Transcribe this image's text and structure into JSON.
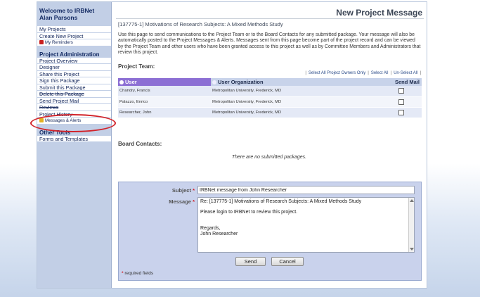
{
  "sidebar": {
    "welcome_line1": "Welcome to IRBNet",
    "welcome_line2": "Alan Parsons",
    "top_items": [
      {
        "label": "My Projects"
      },
      {
        "label": "Create New Project"
      },
      {
        "label": "My Reminders",
        "icon": "reminder-icon",
        "color": "#c8201e"
      }
    ],
    "project_admin_heading": "Project Administration",
    "admin_items": [
      {
        "label": "Project Overview"
      },
      {
        "label": "Designer"
      },
      {
        "label": "Share this Project"
      },
      {
        "label": "Sign this Package"
      },
      {
        "label": "Submit this Package"
      },
      {
        "label": "Delete this Package"
      },
      {
        "label": "Send Project Mail"
      },
      {
        "label": "Reviews"
      },
      {
        "label": "Project History"
      },
      {
        "label": "Messages & Alerts",
        "icon": "messages-icon",
        "color": "#e3b11f"
      }
    ],
    "other_tools_heading": "Other Tools",
    "other_items": [
      {
        "label": "Forms and Templates"
      }
    ]
  },
  "header": {
    "page_title": "New Project Message",
    "project_title": "[137775-1] Motivations of Research Subjects: A Mixed Methods Study"
  },
  "intro_text": "Use this page to send communications to the Project Team or to the Board Contacts for any submitted package. Your message will also be automatically posted to the Project Messages & Alerts. Messages sent from this page become part of the project record and can be viewed by the Project Team and other users who have been granted access to this project as well as by Committee Members and Administrators that review this project.",
  "team": {
    "label": "Project Team:",
    "links": {
      "select_owners": "Select All Project Owners Only",
      "select_all": "Select All",
      "unselect_all": "Un-Select All"
    },
    "columns": {
      "user": "User",
      "organization": "User Organization",
      "send_mail": "Send Mail"
    },
    "rows": [
      {
        "user": "Chandry, Francis",
        "organization": "Metropolitan University, Frederick, MD",
        "send_mail": false
      },
      {
        "user": "Palazzo, Enrico",
        "organization": "Metropolitan University, Frederick, MD",
        "send_mail": false
      },
      {
        "user": "Researcher, John",
        "organization": "Metropolitan University, Frederick, MD",
        "send_mail": false
      }
    ]
  },
  "board": {
    "label": "Board Contacts:",
    "empty_text": "There are no submitted packages."
  },
  "form": {
    "subject_label": "Subject",
    "subject_value": "IRBNet message from John Researcher",
    "message_label": "Message",
    "message_line1": "Re: [137775-1] Motivations of Research Subjects: A Mixed Methods Study",
    "message_line2": "Please login to IRBNet to review this project.",
    "message_line3": "Regards,",
    "message_line4": "John Researcher",
    "send_label": "Send",
    "cancel_label": "Cancel",
    "required_note": "required fields",
    "required_mark": "*"
  },
  "colors": {
    "highlight_circle": "#d2232a",
    "sidebar_bg": "#c2cfe6",
    "user_header": "#8c6fd4"
  }
}
